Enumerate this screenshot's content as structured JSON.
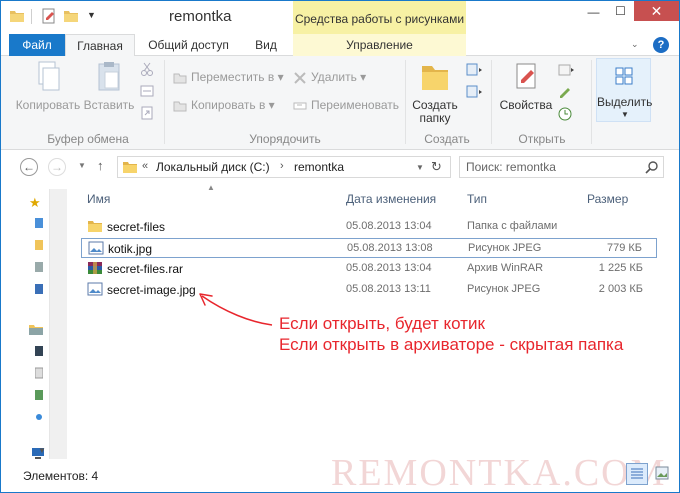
{
  "window": {
    "title": "remontka",
    "context_tab_title": "Средства работы с рисунками"
  },
  "tabs": {
    "file": "Файл",
    "home": "Главная",
    "share": "Общий доступ",
    "view": "Вид",
    "manage": "Управление"
  },
  "ribbon": {
    "clipboard": {
      "copy": "Копировать",
      "paste": "Вставить",
      "group_label": "Буфер обмена"
    },
    "organize": {
      "move_to": "Переместить в",
      "copy_to": "Копировать в",
      "delete": "Удалить",
      "rename": "Переименовать",
      "group_label": "Упорядочить"
    },
    "new": {
      "new_folder_line1": "Создать",
      "new_folder_line2": "папку",
      "group_label": "Создать"
    },
    "open": {
      "properties": "Свойства",
      "group_label": "Открыть"
    },
    "select": {
      "select_label": "Выделить"
    }
  },
  "address": {
    "prefix": "«",
    "drive": "Локальный диск (C:)",
    "folder": "remontka",
    "separator": "›"
  },
  "search": {
    "placeholder": "Поиск: remontka"
  },
  "columns": {
    "name": "Имя",
    "date": "Дата изменения",
    "type": "Тип",
    "size": "Размер"
  },
  "files": [
    {
      "name": "secret-files",
      "date": "05.08.2013 13:04",
      "type": "Папка с файлами",
      "size": "",
      "icon": "folder-icon"
    },
    {
      "name": "kotik.jpg",
      "date": "05.08.2013 13:08",
      "type": "Рисунок JPEG",
      "size": "779 КБ",
      "icon": "image-file-icon"
    },
    {
      "name": "secret-files.rar",
      "date": "05.08.2013 13:04",
      "type": "Архив WinRAR",
      "size": "1 225 КБ",
      "icon": "winrar-archive-icon"
    },
    {
      "name": "secret-image.jpg",
      "date": "05.08.2013 13:11",
      "type": "Рисунок JPEG",
      "size": "2 003 КБ",
      "icon": "image-file-icon"
    }
  ],
  "annotation": {
    "line1": "Если открыть, будет котик",
    "line2": "Если открыть в архиваторе - скрытая папка",
    "color": "#e8262d"
  },
  "status": {
    "items_count": "Элементов: 4"
  },
  "watermark": "REMONTKA.COM",
  "colors": {
    "accent": "#1979ca",
    "context_tab": "#f7f1a4",
    "close_button": "#c75050"
  }
}
